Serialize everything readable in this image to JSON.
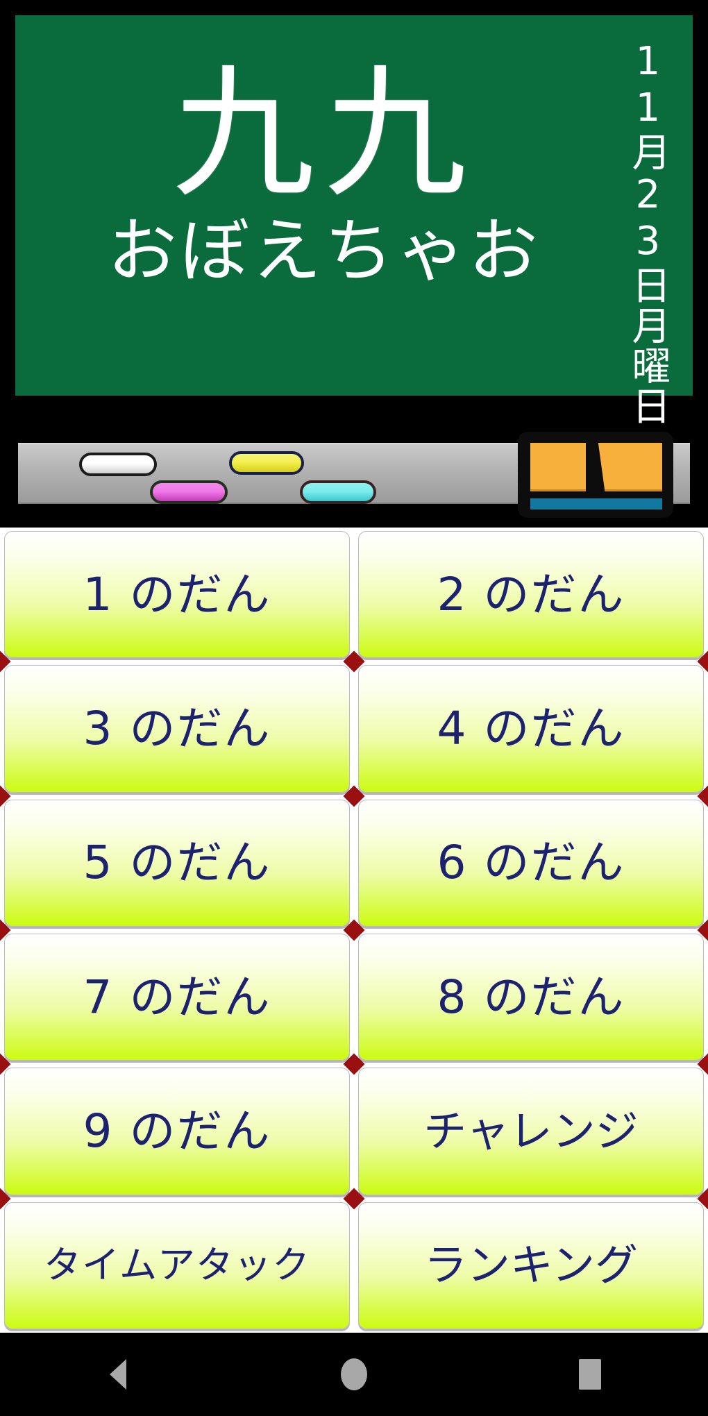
{
  "blackboard": {
    "title": "九九",
    "subtitle": "おぼえちゃお",
    "date": "11月23日月曜日"
  },
  "chalk_tray": {
    "chalks": [
      {
        "name": "chalk-white",
        "color": "#ffffff"
      },
      {
        "name": "chalk-magenta",
        "color": "#ef7ae8"
      },
      {
        "name": "chalk-yellow",
        "color": "#f4ef4d"
      },
      {
        "name": "chalk-cyan",
        "color": "#7cecec"
      }
    ],
    "eraser": {
      "body_color": "#f7b03c",
      "felt_color": "#1278a0"
    }
  },
  "menu": {
    "buttons": [
      {
        "label": "1 のだん",
        "size": "normal"
      },
      {
        "label": "2 のだん",
        "size": "normal"
      },
      {
        "label": "3 のだん",
        "size": "normal"
      },
      {
        "label": "4 のだん",
        "size": "normal"
      },
      {
        "label": "5 のだん",
        "size": "normal"
      },
      {
        "label": "6 のだん",
        "size": "normal"
      },
      {
        "label": "7 のだん",
        "size": "normal"
      },
      {
        "label": "8 のだん",
        "size": "normal"
      },
      {
        "label": "9 のだん",
        "size": "normal"
      },
      {
        "label": "チャレンジ",
        "size": "wide"
      },
      {
        "label": "タイムアタック",
        "size": "small"
      },
      {
        "label": "ランキング",
        "size": "wide"
      }
    ]
  },
  "navbar": {
    "back_label": "back-button",
    "home_label": "home-button",
    "recent_label": "recent-apps-button"
  },
  "colors": {
    "board_green": "#0a6b3c",
    "button_green": "#ccfb10",
    "button_text": "#1d2270",
    "marker_red": "#9a0f10"
  }
}
